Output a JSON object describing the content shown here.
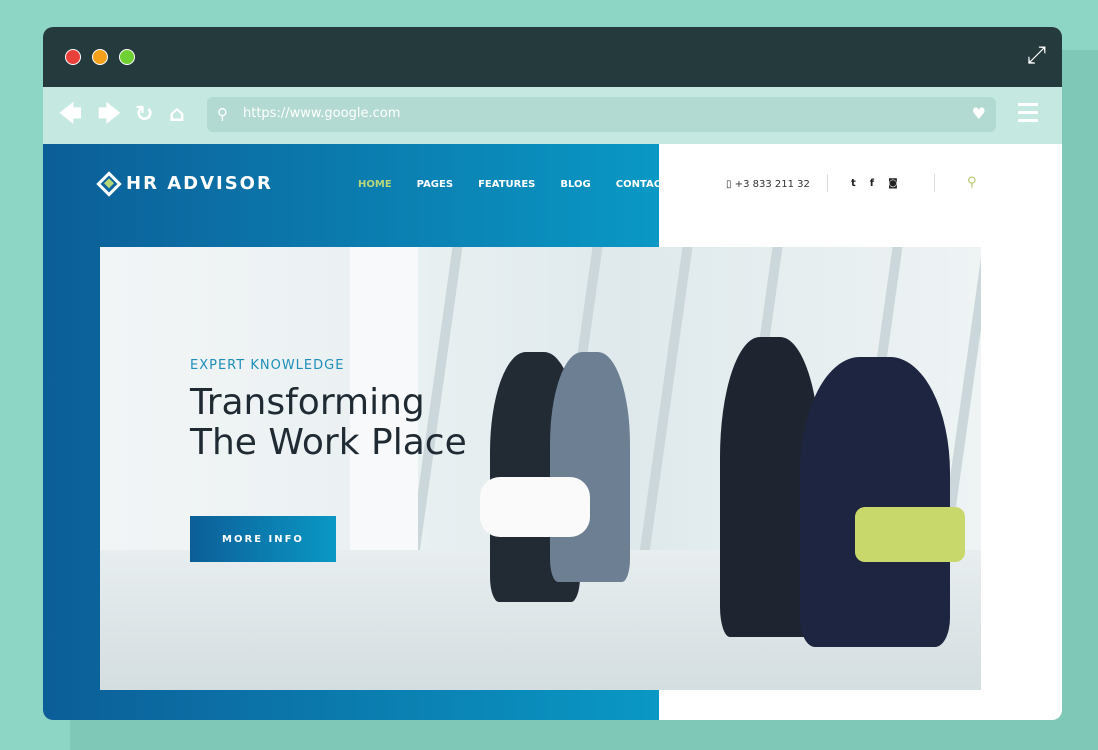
{
  "browser": {
    "url": "https://www.google.com",
    "traffic_lights": [
      "#e9403a",
      "#f5a01b",
      "#6fd033"
    ]
  },
  "site": {
    "logo": "HR ADVISOR",
    "nav": [
      {
        "label": "HOME",
        "active": true
      },
      {
        "label": "PAGES"
      },
      {
        "label": "FEATURES"
      },
      {
        "label": "BLOG"
      },
      {
        "label": "CONTACTS"
      }
    ],
    "phone": "+3 833 211 32",
    "social": [
      "twitter-icon",
      "facebook-icon",
      "instagram-icon"
    ]
  },
  "hero": {
    "subtitle": "EXPERT KNOWLEDGE",
    "title_line1": "Transforming",
    "title_line2": "The Work Place",
    "button": "MORE INFO"
  },
  "colors": {
    "accent": "#b7d77a",
    "blue_dark": "#0c5e98",
    "blue_light": "#0a98c4",
    "titlebar": "#253a3d",
    "toolbar": "#c5e9e0"
  }
}
